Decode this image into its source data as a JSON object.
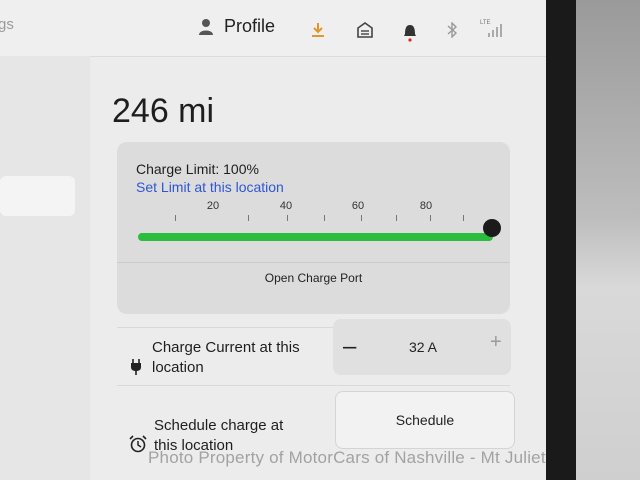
{
  "topbar": {
    "left_tab_text": "gs",
    "profile_label": "Profile",
    "lte_label": "LTE"
  },
  "main": {
    "range": "246 mi"
  },
  "charge_card": {
    "limit_label": "Charge Limit: 100%",
    "limit_value_percent": 100,
    "set_limit_link": "Set Limit at this location",
    "slider_ticks": [
      "20",
      "40",
      "60",
      "80"
    ],
    "open_port_button": "Open Charge Port",
    "colors": {
      "fill": "#2abd3e",
      "link": "#2e57d6",
      "knob": "#1b1b1b"
    }
  },
  "charge_current": {
    "label_line1": "Charge Current at this",
    "label_line2": "location",
    "minus_label": "–",
    "value": "32 A",
    "plus_label": "+"
  },
  "schedule": {
    "label_line1": "Schedule charge at",
    "label_line2": "this location",
    "button_label": "Schedule"
  },
  "watermark": "Photo Property of MotorCars of Nashville - Mt Juliet",
  "icons": [
    "person-icon",
    "download-icon",
    "garage-icon",
    "bell-icon",
    "bluetooth-icon",
    "signal-icon",
    "plug-icon",
    "alarm-clock-icon"
  ]
}
